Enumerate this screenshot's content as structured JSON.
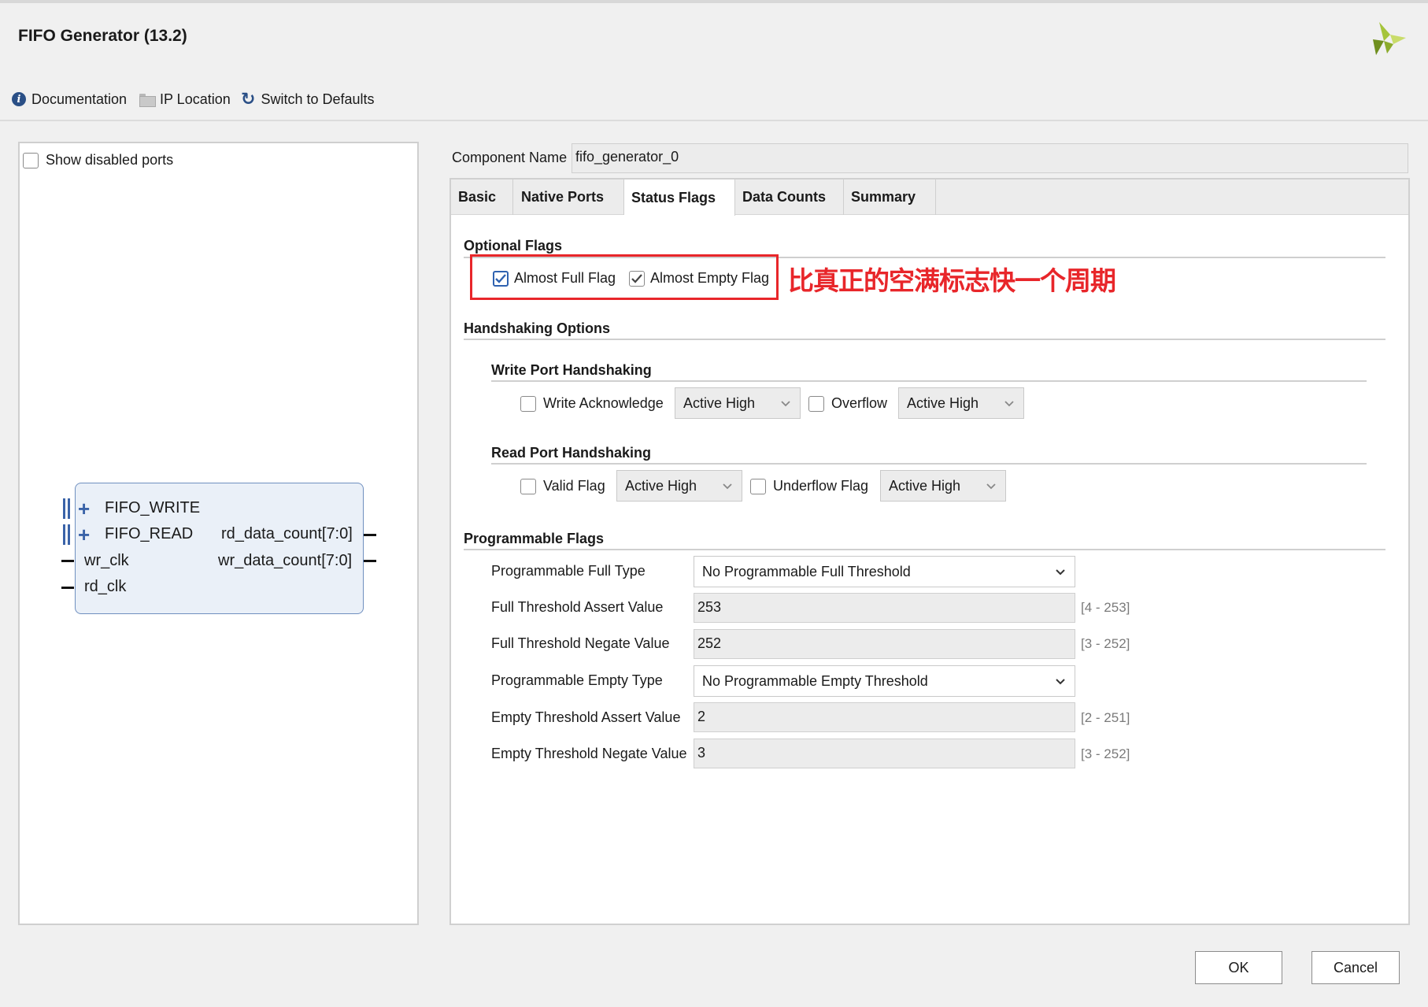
{
  "window": {
    "title": "FIFO Generator (13.2)"
  },
  "toolbar": {
    "documentation": "Documentation",
    "ip_location": "IP Location",
    "switch_defaults": "Switch to Defaults"
  },
  "left": {
    "show_disabled_ports": "Show disabled ports",
    "show_disabled_checked": false,
    "symbol": {
      "left_ports": [
        "FIFO_WRITE",
        "FIFO_READ",
        "wr_clk",
        "rd_clk"
      ],
      "right_ports": [
        "rd_data_count[7:0]",
        "wr_data_count[7:0]"
      ]
    }
  },
  "component": {
    "label": "Component Name",
    "value": "fifo_generator_0"
  },
  "tabs": [
    {
      "label": "Basic",
      "active": false
    },
    {
      "label": "Native Ports",
      "active": false
    },
    {
      "label": "Status Flags",
      "active": true
    },
    {
      "label": "Data Counts",
      "active": false
    },
    {
      "label": "Summary",
      "active": false
    }
  ],
  "optional_flags": {
    "title": "Optional Flags",
    "almost_full": {
      "label": "Almost Full Flag",
      "checked": true
    },
    "almost_empty": {
      "label": "Almost Empty Flag",
      "checked": true
    },
    "annotation": "比真正的空满标志快一个周期"
  },
  "handshaking": {
    "title": "Handshaking Options",
    "write": {
      "title": "Write Port Handshaking",
      "write_ack": {
        "label": "Write Acknowledge",
        "checked": false,
        "polarity": "Active High"
      },
      "overflow": {
        "label": "Overflow",
        "checked": false,
        "polarity": "Active High"
      }
    },
    "read": {
      "title": "Read Port Handshaking",
      "valid": {
        "label": "Valid Flag",
        "checked": false,
        "polarity": "Active High"
      },
      "underflow": {
        "label": "Underflow Flag",
        "checked": false,
        "polarity": "Active High"
      }
    }
  },
  "programmable": {
    "title": "Programmable Flags",
    "full_type": {
      "label": "Programmable Full Type",
      "value": "No Programmable Full Threshold"
    },
    "full_assert": {
      "label": "Full Threshold Assert Value",
      "value": "253",
      "range": "[4 - 253]"
    },
    "full_negate": {
      "label": "Full Threshold Negate Value",
      "value": "252",
      "range": "[3 - 252]"
    },
    "empty_type": {
      "label": "Programmable Empty Type",
      "value": "No Programmable Empty Threshold"
    },
    "empty_assert": {
      "label": "Empty Threshold Assert Value",
      "value": "2",
      "range": "[2 - 251]"
    },
    "empty_negate": {
      "label": "Empty Threshold Negate Value",
      "value": "3",
      "range": "[3 - 252]"
    }
  },
  "buttons": {
    "ok": "OK",
    "cancel": "Cancel"
  },
  "colors": {
    "accent": "#2f62b0",
    "annotation": "#e8262a",
    "symbol_fill": "#eaf0f8"
  }
}
